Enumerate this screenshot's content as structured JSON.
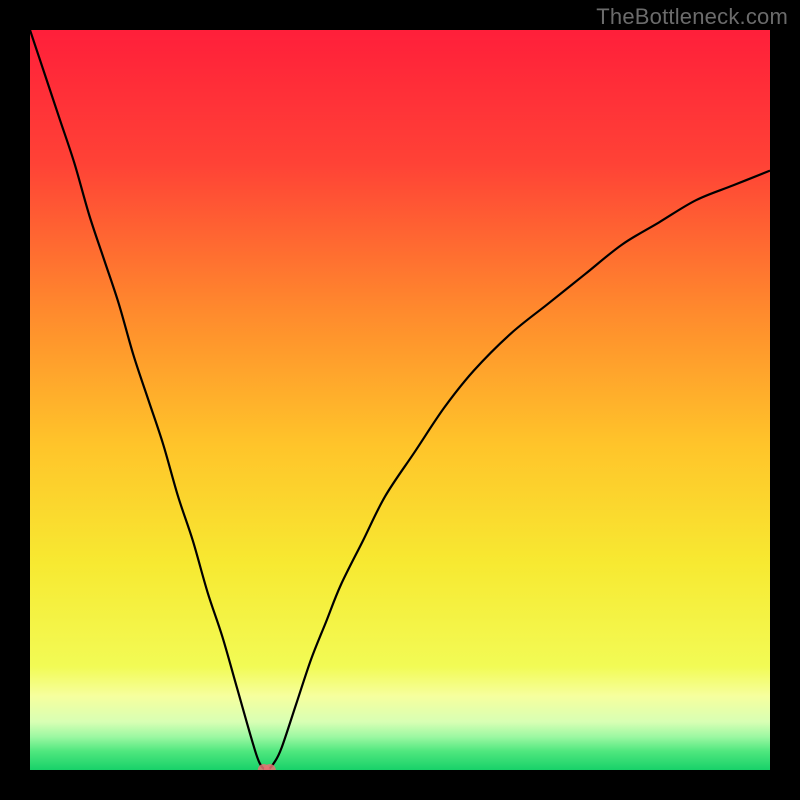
{
  "watermark": "TheBottleneck.com",
  "chart_data": {
    "type": "line",
    "title": "",
    "xlabel": "",
    "ylabel": "",
    "xlim": [
      0,
      100
    ],
    "ylim": [
      0,
      100
    ],
    "x": [
      0,
      2,
      4,
      6,
      8,
      10,
      12,
      14,
      16,
      18,
      20,
      22,
      24,
      26,
      28,
      30,
      31,
      32,
      33,
      34,
      36,
      38,
      40,
      42,
      45,
      48,
      52,
      56,
      60,
      65,
      70,
      75,
      80,
      85,
      90,
      95,
      100
    ],
    "values": [
      100,
      94,
      88,
      82,
      75,
      69,
      63,
      56,
      50,
      44,
      37,
      31,
      24,
      18,
      11,
      4,
      1,
      0,
      1,
      3,
      9,
      15,
      20,
      25,
      31,
      37,
      43,
      49,
      54,
      59,
      63,
      67,
      71,
      74,
      77,
      79,
      81
    ],
    "min_marker": {
      "x": 32,
      "y": 0,
      "color": "#e57373"
    },
    "gradient_stops": [
      {
        "offset": 0,
        "color": "#ff1f3a"
      },
      {
        "offset": 0.18,
        "color": "#ff4236"
      },
      {
        "offset": 0.38,
        "color": "#ff8a2d"
      },
      {
        "offset": 0.56,
        "color": "#ffc42a"
      },
      {
        "offset": 0.72,
        "color": "#f7e931"
      },
      {
        "offset": 0.86,
        "color": "#f2fb55"
      },
      {
        "offset": 0.9,
        "color": "#f6ff9e"
      },
      {
        "offset": 0.935,
        "color": "#d8ffb4"
      },
      {
        "offset": 0.955,
        "color": "#9cf8a2"
      },
      {
        "offset": 0.975,
        "color": "#4fe77e"
      },
      {
        "offset": 1.0,
        "color": "#17d169"
      }
    ]
  }
}
